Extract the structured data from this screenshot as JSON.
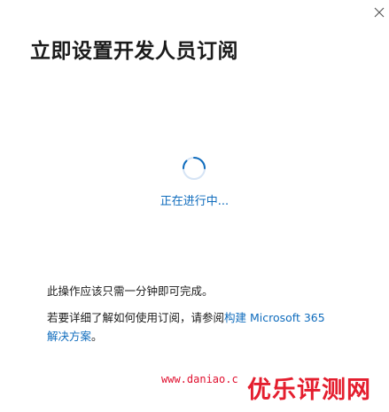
{
  "dialog": {
    "title": "立即设置开发人员订阅",
    "close_icon": "close-icon",
    "status_text": "正在进行中...",
    "info_text": "此操作应该只需一分钟即可完成。",
    "learn_prefix": "若要详细了解如何使用订阅，请参阅",
    "learn_link": "构建 Microsoft 365 解决方案",
    "learn_suffix": "。",
    "accent_color": "#0f6cbd"
  },
  "watermark": {
    "url": "www.daniao.c",
    "brand": "优乐评测网",
    "color": "#e41e2e"
  }
}
